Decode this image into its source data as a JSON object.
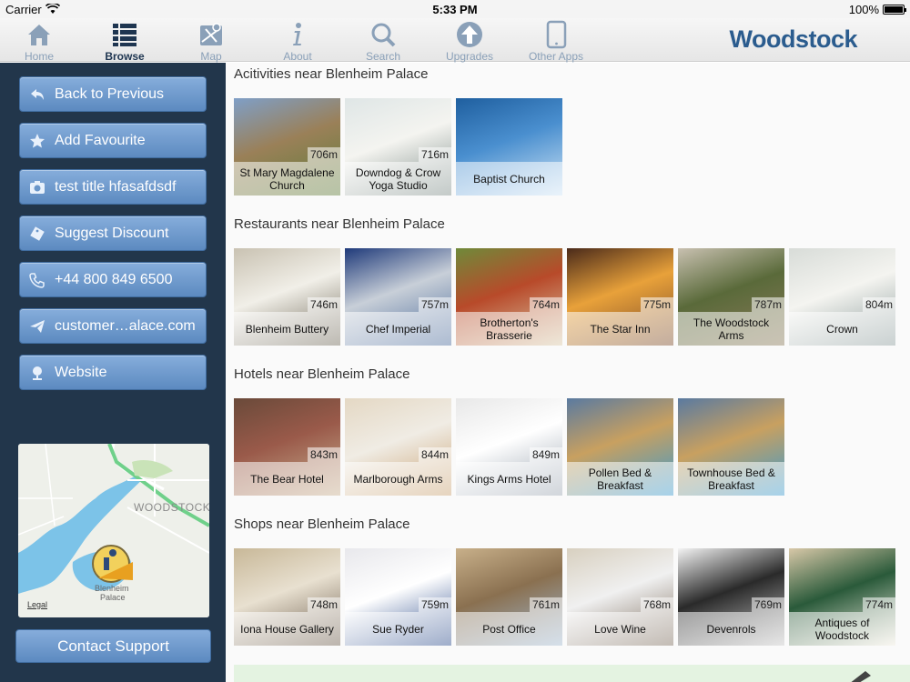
{
  "status_bar": {
    "carrier": "Carrier",
    "time": "5:33 PM",
    "battery": "100%"
  },
  "nav": {
    "tabs": [
      {
        "label": "Home",
        "icon": "home-icon"
      },
      {
        "label": "Browse",
        "icon": "list-icon",
        "active": true
      },
      {
        "label": "Map",
        "icon": "map-icon"
      },
      {
        "label": "About",
        "icon": "info-icon"
      },
      {
        "label": "Search",
        "icon": "search-icon"
      },
      {
        "label": "Upgrades",
        "icon": "upgrade-arrow-icon"
      },
      {
        "label": "Other Apps",
        "icon": "tablet-icon"
      }
    ],
    "brand": "Woodstock"
  },
  "sidebar": {
    "buttons": [
      {
        "label": "Back to Previous",
        "icon": "back-arrow-icon"
      },
      {
        "label": "Add Favourite",
        "icon": "star-icon"
      },
      {
        "label": "test title hfasafdsdf",
        "icon": "camera-icon"
      },
      {
        "label": "Suggest Discount",
        "icon": "ticket-icon"
      },
      {
        "label": "+44 800 849 6500",
        "icon": "phone-icon"
      },
      {
        "label": "customer…alace.com",
        "icon": "send-icon"
      },
      {
        "label": "Website",
        "icon": "globe-icon"
      }
    ],
    "map": {
      "town_label": "WOODSTOCK",
      "pin_label_line1": "Blenheim",
      "pin_label_line2": "Palace",
      "legal": "Legal"
    },
    "contact_support": "Contact Support"
  },
  "sections": [
    {
      "title": "Acitivities near Blenheim Palace",
      "items": [
        {
          "name": "St Mary Magdalene Church",
          "distance": "706m",
          "colors": [
            "#7f9fc7",
            "#9a8058",
            "#5f7d3a"
          ]
        },
        {
          "name": "Downdog & Crow Yoga Studio",
          "distance": "716m",
          "colors": [
            "#dfe6e6",
            "#f4f4f0",
            "#7b8a86"
          ]
        },
        {
          "name": "Baptist Church",
          "distance": "",
          "colors": [
            "#1f5f9f",
            "#4a8fcf",
            "#cfe4f5"
          ]
        }
      ]
    },
    {
      "title": "Restaurants near Blenheim Palace",
      "items": [
        {
          "name": "Blenheim Buttery",
          "distance": "746m",
          "colors": [
            "#c9c2b2",
            "#f1efe8",
            "#6d6656"
          ]
        },
        {
          "name": "Chef Imperial",
          "distance": "757m",
          "colors": [
            "#1f3a7a",
            "#c8cfd8",
            "#4a6a9a"
          ]
        },
        {
          "name": "Brotherton's Brasserie",
          "distance": "764m",
          "colors": [
            "#6f8a3a",
            "#b84a2a",
            "#d9c9a8"
          ]
        },
        {
          "name": "The Star Inn",
          "distance": "775m",
          "colors": [
            "#4a2a1a",
            "#e8a13a",
            "#7a4a2a"
          ]
        },
        {
          "name": "The Woodstock Arms",
          "distance": "787m",
          "colors": [
            "#c8c0b0",
            "#5a6a3a",
            "#8a7a5a"
          ]
        },
        {
          "name": "Crown",
          "distance": "804m",
          "colors": [
            "#d8dcd8",
            "#f4f4f0",
            "#8a9a9a"
          ]
        }
      ]
    },
    {
      "title": "Hotels near Blenheim Palace",
      "items": [
        {
          "name": "The Bear Hotel",
          "distance": "843m",
          "colors": [
            "#6a4a3a",
            "#9a5a4a",
            "#c8b090"
          ]
        },
        {
          "name": "Marlborough Arms",
          "distance": "844m",
          "colors": [
            "#e4d8c4",
            "#f0ece4",
            "#c8a070"
          ]
        },
        {
          "name": "Kings Arms Hotel",
          "distance": "849m",
          "colors": [
            "#e8e8e8",
            "#ffffff",
            "#9aa4b0"
          ]
        },
        {
          "name": "Pollen Bed & Breakfast",
          "distance": "",
          "colors": [
            "#5a7aa0",
            "#c8a060",
            "#3a9ad0"
          ]
        },
        {
          "name": "Townhouse Bed & Breakfast",
          "distance": "",
          "colors": [
            "#5a7aa0",
            "#c8a060",
            "#3a9ad0"
          ]
        }
      ]
    },
    {
      "title": "Shops near Blenheim Palace",
      "items": [
        {
          "name": "Iona House Gallery",
          "distance": "748m",
          "colors": [
            "#c8b898",
            "#e8e0d0",
            "#6a5a4a"
          ]
        },
        {
          "name": "Sue Ryder",
          "distance": "759m",
          "colors": [
            "#e8e8ec",
            "#ffffff",
            "#2a4a8a"
          ]
        },
        {
          "name": "Post Office",
          "distance": "761m",
          "colors": [
            "#c8b08a",
            "#8a7050",
            "#a0b8d0"
          ]
        },
        {
          "name": "Love Wine",
          "distance": "768m",
          "colors": [
            "#d8d0c0",
            "#f0f0f0",
            "#7a6a5a"
          ]
        },
        {
          "name": "Devenrols",
          "distance": "769m",
          "colors": [
            "#f4f4f4",
            "#2a2a2a",
            "#c8c8c8"
          ]
        },
        {
          "name": "Antiques of Woodstock",
          "distance": "774m",
          "colors": [
            "#d8c8a8",
            "#2a5a3a",
            "#f0ece0"
          ]
        }
      ]
    }
  ]
}
